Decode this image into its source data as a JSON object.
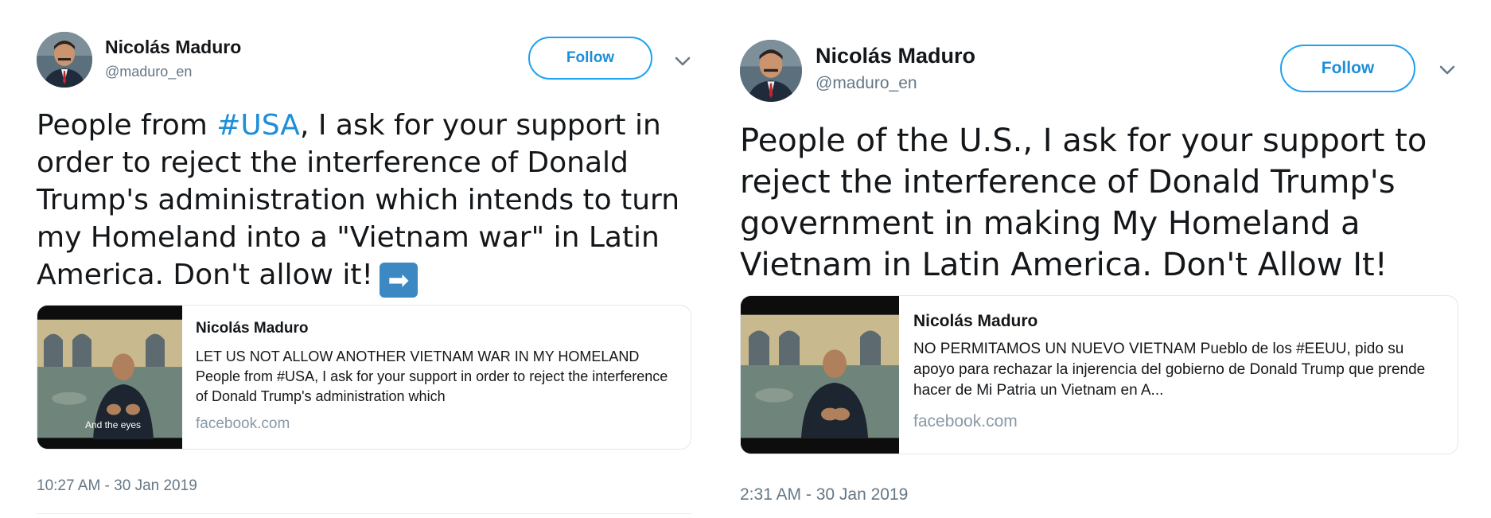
{
  "tweets": [
    {
      "author": {
        "name": "Nicolás Maduro",
        "handle": "@maduro_en"
      },
      "follow_label": "Follow",
      "text": {
        "before": "People from ",
        "hashtag": "#USA",
        "after": ", I ask for your support in order to reject the interference of Donald Trump's administration which intends to turn my Homeland into a \"Vietnam war\" in Latin America. Don't allow it!",
        "emoji": "➡"
      },
      "card": {
        "title": "Nicolás Maduro",
        "description": "LET US NOT ALLOW ANOTHER VIETNAM WAR IN MY HOMELAND People from #USA, I ask for your support in order to reject the interference of Donald Trump's administration which",
        "domain": "facebook.com",
        "thumbnail_caption": "And the eyes"
      },
      "timestamp": "10:27 AM - 30 Jan 2019"
    },
    {
      "author": {
        "name": "Nicolás Maduro",
        "handle": "@maduro_en"
      },
      "follow_label": "Follow",
      "text": {
        "full": "People of the U.S., I ask for your support to reject the interference of Donald Trump's government in making My Homeland a Vietnam in Latin America. Don't Allow It!"
      },
      "card": {
        "title": "Nicolás Maduro",
        "description": "NO PERMITAMOS UN NUEVO VIETNAM Pueblo de los #EEUU, pido su apoyo para rechazar la injerencia del gobierno de Donald Trump que prende hacer de Mi Patria un Vietnam en A...",
        "domain": "facebook.com"
      },
      "timestamp": "2:31 AM - 30 Jan 2019"
    }
  ],
  "colors": {
    "link_blue": "#1d8ed8",
    "follow_border": "#1da1f2",
    "secondary_text": "#657786",
    "card_border": "#e1e8ed",
    "emoji_bg": "#3b88c3"
  },
  "icons": [
    "avatar",
    "chevron-down-icon",
    "right-arrow-emoji",
    "video-thumbnail"
  ]
}
